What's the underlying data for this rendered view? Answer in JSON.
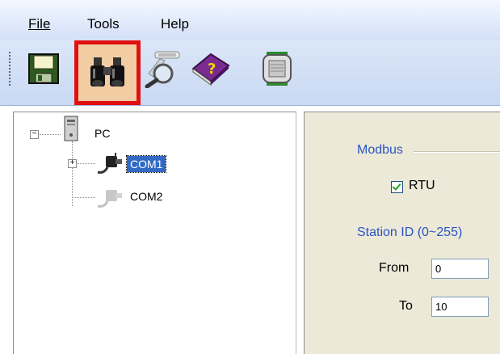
{
  "menu": {
    "file": "File",
    "tools": "Tools",
    "help": "Help"
  },
  "toolbar": {
    "buttons": [
      {
        "icon": "save-icon",
        "selected": false
      },
      {
        "icon": "binoculars-icon",
        "selected": true
      },
      {
        "icon": "scan-icon",
        "selected": false
      },
      {
        "icon": "help-book-icon",
        "selected": false
      },
      {
        "icon": "device-icon",
        "selected": false
      }
    ]
  },
  "tree": {
    "root": "PC",
    "children": [
      {
        "label": "COM1",
        "selected": true,
        "expandable": true
      },
      {
        "label": "COM2",
        "selected": false,
        "expandable": false
      }
    ]
  },
  "settings": {
    "modbus_title": "Modbus",
    "rtu_label": "RTU",
    "rtu_checked": true,
    "station_title": "Station ID (0~255)",
    "from_label": "From",
    "from_value": "0",
    "to_label": "To",
    "to_value": "10"
  },
  "colors": {
    "selection": "#316ac5",
    "highlight_border": "#e01010",
    "group_title": "#2a55c4"
  }
}
